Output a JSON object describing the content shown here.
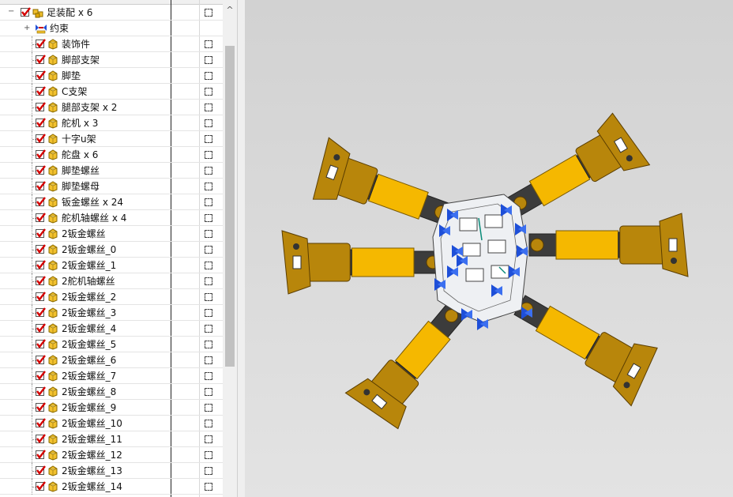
{
  "assembly_tree": {
    "root": {
      "label": "足装配 x 6",
      "expand_glyph": "−",
      "checked": true
    },
    "constraints": {
      "label": "约束",
      "expand_glyph": "+"
    },
    "items": [
      {
        "label": "装饰件"
      },
      {
        "label": "脚部支架"
      },
      {
        "label": "脚垫"
      },
      {
        "label": "C支架"
      },
      {
        "label": "腿部支架 x 2"
      },
      {
        "label": "舵机 x 3"
      },
      {
        "label": "十字u架"
      },
      {
        "label": "舵盘 x 6"
      },
      {
        "label": "脚垫螺丝"
      },
      {
        "label": "脚垫螺母"
      },
      {
        "label": "钣金螺丝 x 24"
      },
      {
        "label": "舵机轴螺丝 x 4"
      },
      {
        "label": "2钣金螺丝"
      },
      {
        "label": "2钣金螺丝_0"
      },
      {
        "label": "2钣金螺丝_1"
      },
      {
        "label": "2舵机轴螺丝"
      },
      {
        "label": "2钣金螺丝_2"
      },
      {
        "label": "2钣金螺丝_3"
      },
      {
        "label": "2钣金螺丝_4"
      },
      {
        "label": "2钣金螺丝_5"
      },
      {
        "label": "2钣金螺丝_6"
      },
      {
        "label": "2钣金螺丝_7"
      },
      {
        "label": "2钣金螺丝_8"
      },
      {
        "label": "2钣金螺丝_9"
      },
      {
        "label": "2钣金螺丝_10"
      },
      {
        "label": "2钣金螺丝_11"
      },
      {
        "label": "2钣金螺丝_12"
      },
      {
        "label": "2钣金螺丝_13"
      },
      {
        "label": "2钣金螺丝_14"
      }
    ]
  },
  "scrollbar": {
    "up_glyph": "^"
  },
  "viewport": {
    "model": "hexapod-robot-assembly"
  },
  "colors": {
    "check_red": "#d40000",
    "part_icon": "#f2c12e",
    "plate": "#eef0f3",
    "bracket": "#b8860b",
    "servo": "#f5b800",
    "servo_dark": "#3c3c3c",
    "constraint": "#1e4fd8"
  }
}
